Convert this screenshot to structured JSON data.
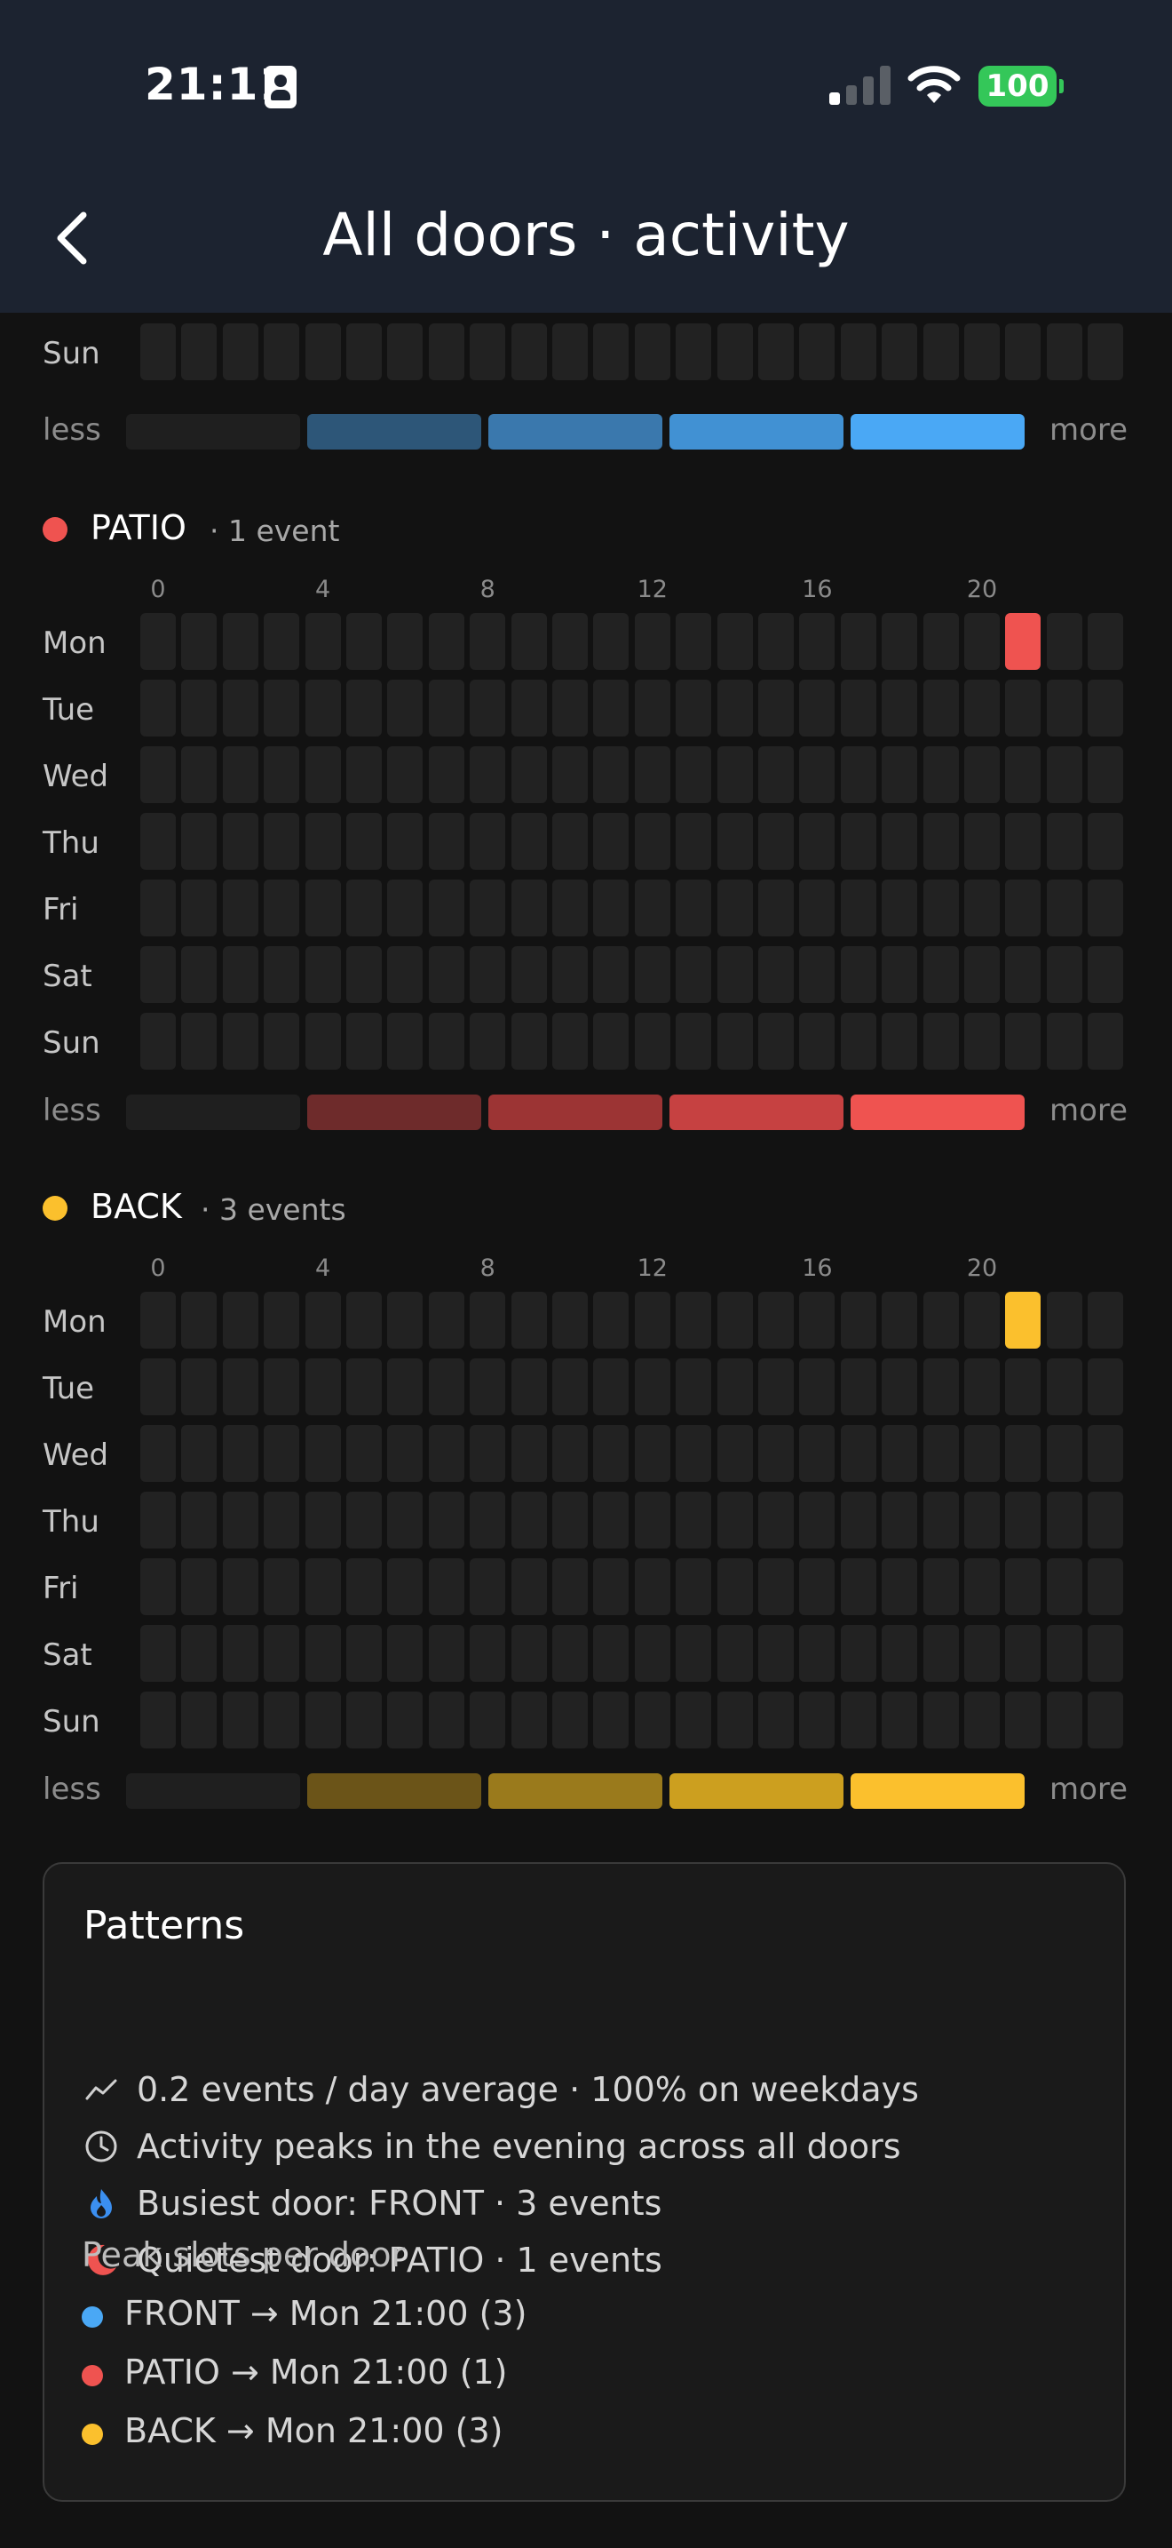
{
  "status_bar": {
    "time": "21:11",
    "battery": "100"
  },
  "nav": {
    "title": "All doors · activity"
  },
  "heatmap_common": {
    "hour_labels": [
      {
        "hour": 0,
        "label": "0"
      },
      {
        "hour": 4,
        "label": "4"
      },
      {
        "hour": 8,
        "label": "8"
      },
      {
        "hour": 12,
        "label": "12"
      },
      {
        "hour": 16,
        "label": "16"
      },
      {
        "hour": 20,
        "label": "20"
      }
    ],
    "legend_less": "less",
    "legend_more": "more",
    "empty_color": "#222222",
    "legend_empty_color": "#1f1f1f"
  },
  "sections": [
    {
      "key": "front",
      "days": [
        "Sun"
      ],
      "active": [],
      "legend_colors": [
        "#1f1f1f",
        "#2d5678",
        "#3a78ad",
        "#4191d3",
        "#4aa8f5"
      ]
    },
    {
      "key": "patio",
      "name": "PATIO",
      "count_text": "· 1 event",
      "dot_color": "#ef5350",
      "days": [
        "Mon",
        "Tue",
        "Wed",
        "Thu",
        "Fri",
        "Sat",
        "Sun"
      ],
      "active": [
        {
          "day": "Mon",
          "hour": 21,
          "color": "#ef5350"
        }
      ],
      "legend_colors": [
        "#1f1f1f",
        "#6e2b2b",
        "#9c3434",
        "#c64141",
        "#ef5350"
      ]
    },
    {
      "key": "back",
      "name": "BACK",
      "count_text": "· 3 events",
      "dot_color": "#fbc02d",
      "days": [
        "Mon",
        "Tue",
        "Wed",
        "Thu",
        "Fri",
        "Sat",
        "Sun"
      ],
      "active": [
        {
          "day": "Mon",
          "hour": 21,
          "color": "#fbc02d"
        }
      ],
      "legend_colors": [
        "#1f1f1f",
        "#6b5418",
        "#9a7a1c",
        "#cc9f1f",
        "#fbc02d"
      ]
    }
  ],
  "patterns": {
    "title": "Patterns",
    "lines": [
      {
        "icon": "trend-line-icon",
        "text": "0.2 events / day average · 100% on weekdays"
      },
      {
        "icon": "clock-icon",
        "text": "Activity peaks in the evening across all doors"
      },
      {
        "icon": "flame-icon",
        "text": "Busiest door: FRONT · 3 events"
      },
      {
        "icon": "moon-icon",
        "text": "Quietest door: PATIO · 1 events"
      }
    ],
    "peak_title": "Peak slots per door",
    "peaks": [
      {
        "text": "FRONT → Mon 21:00 (3)",
        "color": "#4aa8f5"
      },
      {
        "text": "PATIO → Mon 21:00 (1)",
        "color": "#ef5350"
      },
      {
        "text": "BACK → Mon 21:00 (3)",
        "color": "#fbc02d"
      }
    ]
  }
}
